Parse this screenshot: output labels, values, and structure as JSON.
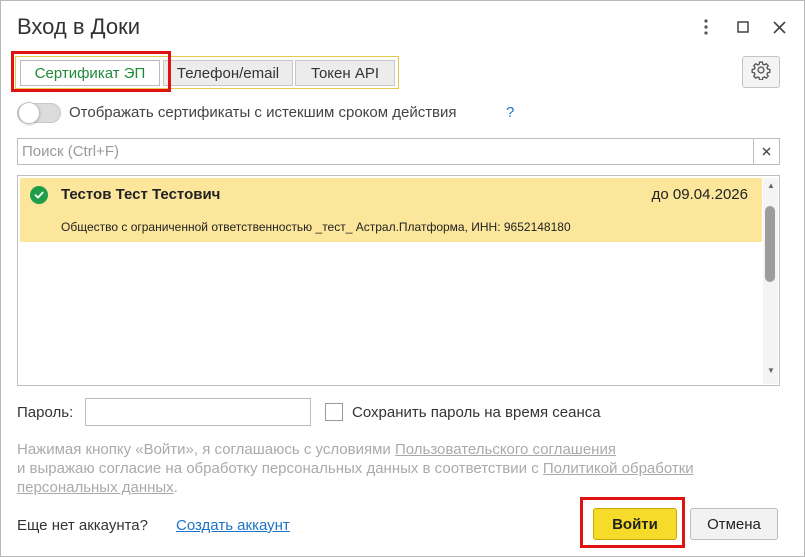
{
  "window": {
    "title": "Вход в Доки",
    "controls": [
      "more-icon",
      "maximize-icon",
      "close-icon"
    ]
  },
  "tabs": [
    {
      "label": "Сертификат ЭП",
      "active": true
    },
    {
      "label": "Телефон/email",
      "active": false
    },
    {
      "label": "Токен API",
      "active": false
    }
  ],
  "settings_icon": "gear-icon",
  "toggle": {
    "label": "Отображать сертификаты с истекшим сроком действия",
    "on": false,
    "help": "?"
  },
  "search": {
    "placeholder": "Поиск (Ctrl+F)",
    "value": ""
  },
  "certificates": [
    {
      "name": "Тестов Тест Тестович",
      "valid_until": "до 09.04.2026",
      "organization": "Общество с ограниченной ответственностью _тест_ Астрал.Платформа, ИНН: 9652148180",
      "selected": true
    }
  ],
  "password": {
    "label": "Пароль:",
    "value": "",
    "save_label": "Сохранить пароль на время сеанса",
    "save_checked": false
  },
  "agreement": {
    "text1": "Нажимая кнопку «Войти», я соглашаюсь с условиями ",
    "link1": "Пользовательского соглашения",
    "text2": "и выражаю согласие на обработку персональных данных в соответствии с ",
    "link2": "Политикой обработки персональных данных",
    "text3": "."
  },
  "footer": {
    "no_account": "Еще нет аккаунта?",
    "create_account": "Создать аккаунт",
    "login": "Войти",
    "cancel": "Отмена"
  },
  "colors": {
    "accent_green": "#1f8a3a",
    "selection": "#fbe69b",
    "primary_button": "#f6dc2a",
    "highlight_red": "#e0120f",
    "link_blue": "#1e73c8"
  }
}
